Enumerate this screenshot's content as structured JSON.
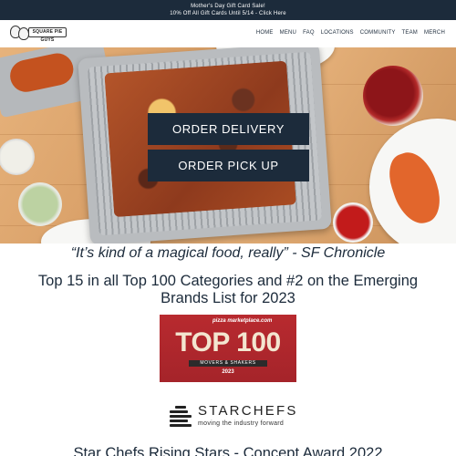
{
  "announcement": {
    "line1": "Mother's Day Gift Card Sale!",
    "line2": "10% Off All Gift Cards Until 5/14 - Click Here"
  },
  "header": {
    "logo_text": "SQUARE PIE GUYS",
    "nav": [
      "HOME",
      "MENU",
      "FAQ",
      "LOCATIONS",
      "COMMUNITY",
      "TEAM",
      "MERCH"
    ]
  },
  "hero": {
    "order_delivery": "ORDER DELIVERY",
    "order_pickup": "ORDER PICK UP"
  },
  "content": {
    "quote": "“It’s kind of a magical food, really” - SF Chronicle",
    "top15": "Top 15 in all Top 100 Categories and #2 on the Emerging Brands List for 2023",
    "badge": {
      "brand": "pizza marketplace.com",
      "title": "TOP 100",
      "band": "MOVERS & SHAKERS",
      "year": "2023"
    },
    "starchefs": {
      "name": "STARCHEFS",
      "tagline": "moving the industry forward"
    },
    "rising": "Star Chefs Rising Stars - Concept Award 2022"
  },
  "colors": {
    "navy": "#1c2b3b",
    "badge_red": "#b82a2f"
  }
}
